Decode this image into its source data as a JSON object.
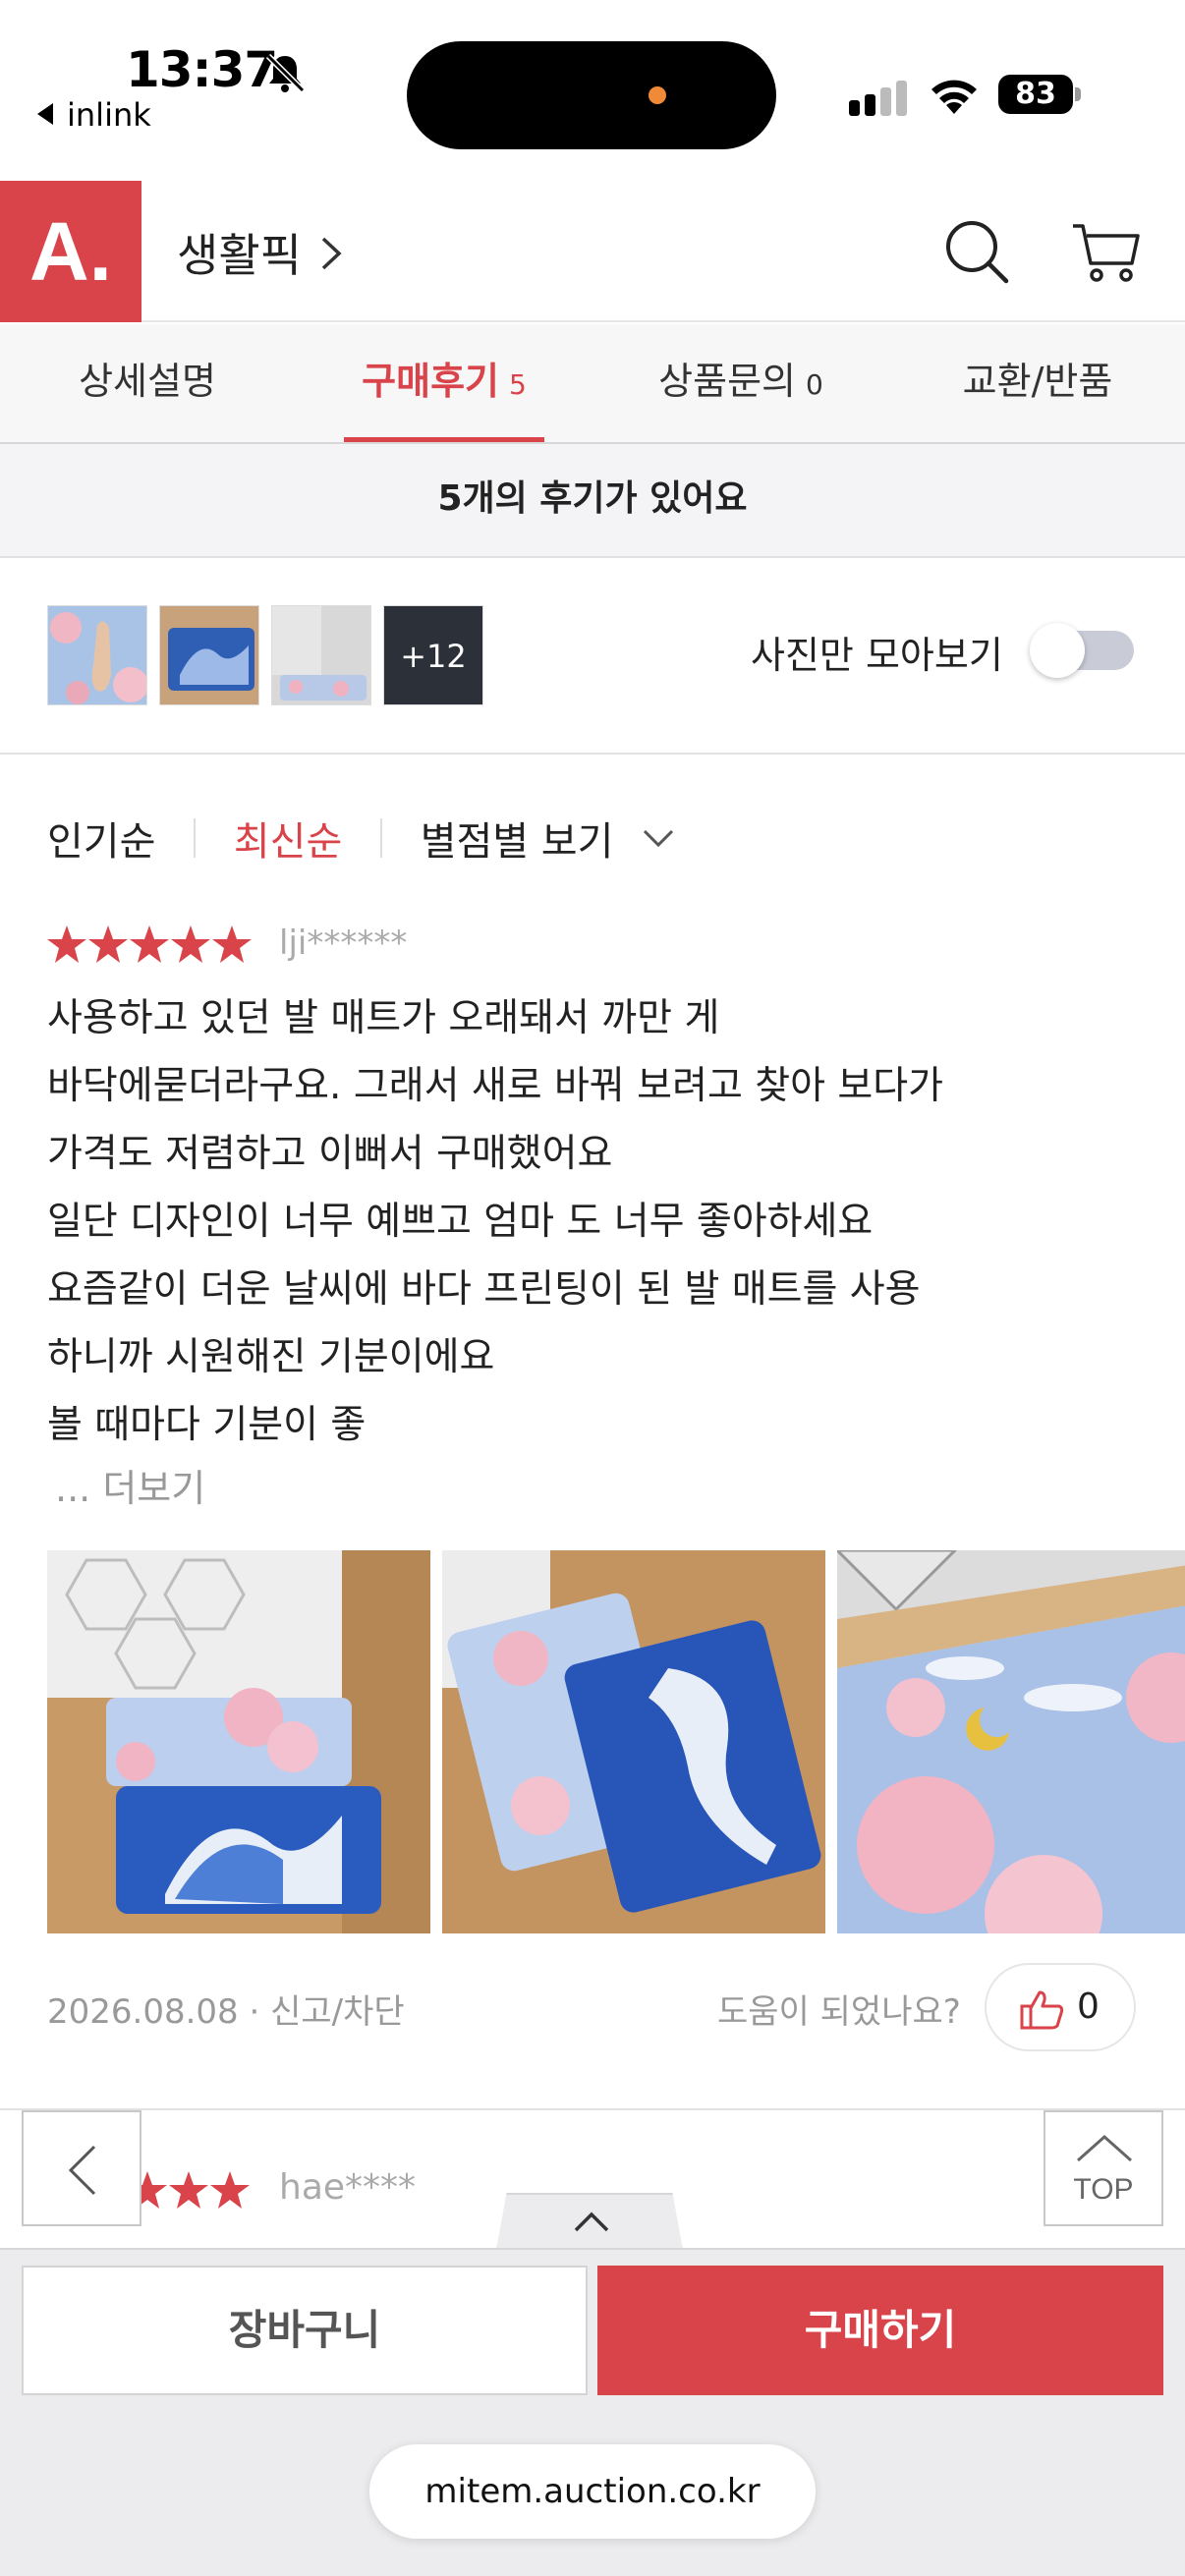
{
  "status_bar": {
    "time": "13:37",
    "back_app": "inlink",
    "battery": "83"
  },
  "header": {
    "logo": "A.",
    "title": "생활픽"
  },
  "tabs": [
    {
      "label": "상세설명",
      "count": ""
    },
    {
      "label": "구매후기",
      "count": "5"
    },
    {
      "label": "상품문의",
      "count": "0"
    },
    {
      "label": "교환/반품",
      "count": ""
    }
  ],
  "review_count_text": "5개의 후기가 있어요",
  "photo_strip": {
    "more_label": "+12",
    "photo_only_label": "사진만 모아보기",
    "photo_only_enabled": false
  },
  "sort": {
    "popular": "인기순",
    "latest": "최신순",
    "by_rating": "별점별 보기",
    "active": "최신순"
  },
  "review1": {
    "rating": 5,
    "user": "lji******",
    "lines": [
      "사용하고 있던 발 매트가 오래돼서 까만 게",
      "바닥에묻더라구요. 그래서 새로 바꿔 보려고 찾아 보다가",
      "가격도 저렴하고 이뻐서 구매했어요",
      "일단 디자인이 너무 예쁘고 엄마 도 너무 좋아하세요",
      "요즘같이 더운 날씨에 바다 프린팅이 된 발 매트를 사용",
      "하니까 시원해진 기분이에요",
      "볼 때마다 기분이 좋"
    ],
    "more": "... 더보기",
    "date": "2026.08.08",
    "report": "신고/차단",
    "helpful_q": "도움이 되었나요?",
    "likes": "0"
  },
  "review2": {
    "user": "hae****"
  },
  "top_button": "TOP",
  "bottom": {
    "cart": "장바구니",
    "buy": "구매하기",
    "url": "mitem.auction.co.kr"
  },
  "colors": {
    "accent": "#d9434a",
    "muted": "#999999"
  }
}
